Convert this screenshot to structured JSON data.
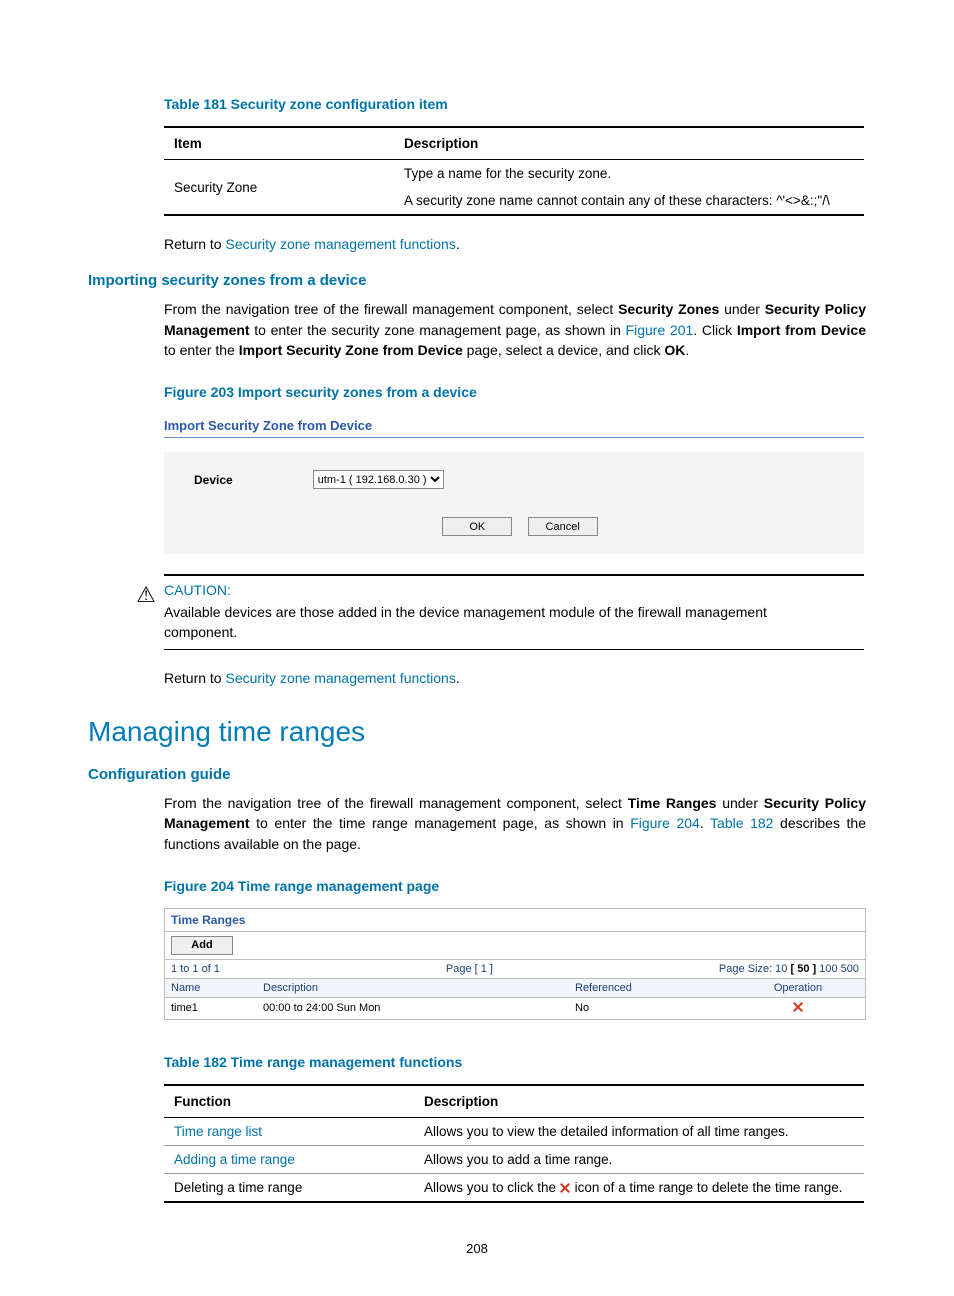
{
  "table181": {
    "caption": "Table 181 Security zone configuration item",
    "head": {
      "c1": "Item",
      "c2": "Description"
    },
    "row": {
      "item": "Security Zone",
      "desc_line1": "Type a name for the security zone.",
      "desc_line2": "A security zone name cannot contain any of these characters: ^'<>&:;\"/\\"
    }
  },
  "return1": {
    "prefix": "Return to ",
    "link": "Security zone management functions",
    "suffix": "."
  },
  "h_importing": "Importing security zones from a device",
  "p_import": {
    "t1": "From the navigation tree of the firewall management component, select ",
    "b1": "Security Zones",
    "t2": " under ",
    "b2": "Security Policy Management",
    "t3": " to enter the security zone management page, as shown in ",
    "lnk": "Figure 201",
    "t4": ". Click ",
    "b3": "Import from Device",
    "t5": " to enter the ",
    "b4": "Import Security Zone from Device",
    "t6": " page, select a device, and click ",
    "b5": "OK",
    "t7": "."
  },
  "fig203": {
    "caption": "Figure 203 Import security zones from a device",
    "panel_title": "Import Security Zone from Device",
    "device_label": "Device",
    "device_value": "utm-1 ( 192.168.0.30 )",
    "ok": "OK",
    "cancel": "Cancel"
  },
  "caution": {
    "label": "CAUTION:",
    "body": "Available devices are those added in the device management module of the firewall management component."
  },
  "return2": {
    "prefix": "Return to ",
    "link": "Security zone management functions",
    "suffix": "."
  },
  "h_managing": "Managing time ranges",
  "h_confguide": "Configuration guide",
  "p_conf": {
    "t1": "From the navigation tree of the firewall management component, select ",
    "b1": "Time Ranges",
    "t2": " under ",
    "b2": "Security Policy Management",
    "t3": " to enter the time range management page, as shown in ",
    "lnk1": "Figure 204",
    "t4": ". ",
    "lnk2": "Table 182",
    "t5": " describes the functions available on the page."
  },
  "fig204": {
    "caption": "Figure 204 Time range management page",
    "panel_title": "Time Ranges",
    "add": "Add",
    "pager_left": "1 to 1 of 1",
    "pager_mid": "Page [ 1 ]",
    "pager_right_prefix": "Page Size: 10 ",
    "pager_right_bold": "[ 50 ]",
    "pager_right_suffix": " 100 500",
    "cols": {
      "name": "Name",
      "desc": "Description",
      "ref": "Referenced",
      "op": "Operation"
    },
    "row": {
      "name": "time1",
      "desc": "00:00 to 24:00 Sun Mon",
      "ref": "No"
    }
  },
  "table182": {
    "caption": "Table 182 Time range management functions",
    "head": {
      "c1": "Function",
      "c2": "Description"
    },
    "r1": {
      "fn": "Time range list",
      "desc": "Allows you to view the detailed information of all time ranges."
    },
    "r2": {
      "fn": "Adding a time range",
      "desc": "Allows you to add a time range."
    },
    "r3": {
      "fn": "Deleting a time range",
      "desc_a": "Allows you to click the ",
      "desc_b": " icon of a time range to delete the time range."
    }
  },
  "page_number": "208"
}
